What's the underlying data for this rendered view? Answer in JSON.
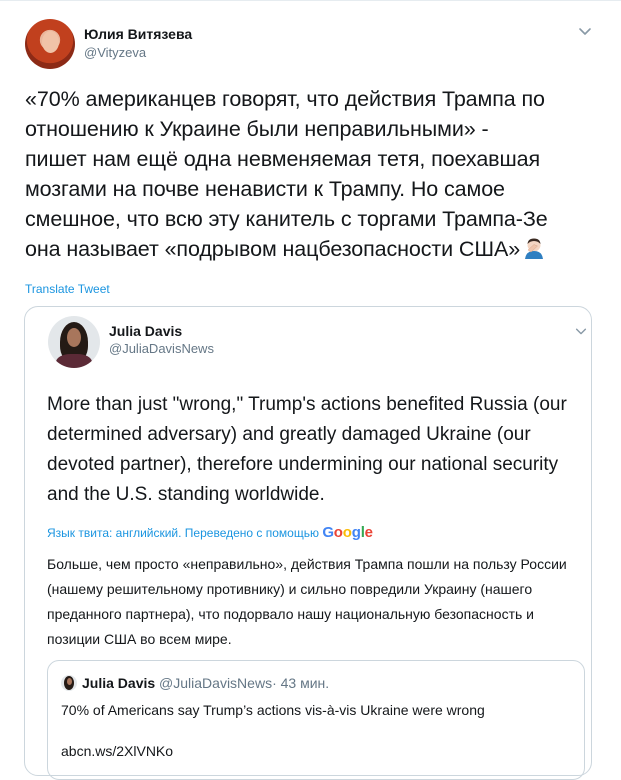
{
  "tweet": {
    "author_name": "Юлия Витязева",
    "author_handle": "@Vityzeva",
    "text": "«70% американцев говорят, что действия Трампа по\nотношению к Украине были неправильными» -\nпишет нам ещё одна невменяемая тетя, поехавшая\nмозгами на почве ненависти к Трампу. Но самое\nсмешное, что всю эту канитель с торгами Трампа-Зе\nона называет «подрывом нацбезопасности США»",
    "emoji_icon": "man-facepalming-icon",
    "translate_label": "Translate Tweet"
  },
  "quoted": {
    "author_name": "Julia Davis",
    "author_handle": "@JuliaDavisNews",
    "text": "More than just \"wrong,\" Trump's actions benefited Russia (our determined adversary) and greatly damaged Ukraine (our devoted partner), therefore undermining our national security and the U.S. standing worldwide.",
    "translated_by_prefix": "Язык твита: английский. Переведено с помощью",
    "translator_name": "Google",
    "translation": "Больше, чем просто «неправильно», действия Трампа пошли на пользу России (нашему решительному противнику) и сильно повредили Украину (нашего преданного партнера), что подорвало нашу национальную безопасность и позиции США во всем мире."
  },
  "nested": {
    "author_name": "Julia Davis",
    "author_handle": "@JuliaDavisNews",
    "separator": "·",
    "time": "43 мин.",
    "text": "70% of Americans say Trump’s actions vis-à-vis Ukraine were wrong",
    "link": "abcn.ws/2XlVNKo"
  },
  "colors": {
    "link_blue": "#1b95e0",
    "secondary_gray": "#657786",
    "border": "#ccd6dd"
  }
}
